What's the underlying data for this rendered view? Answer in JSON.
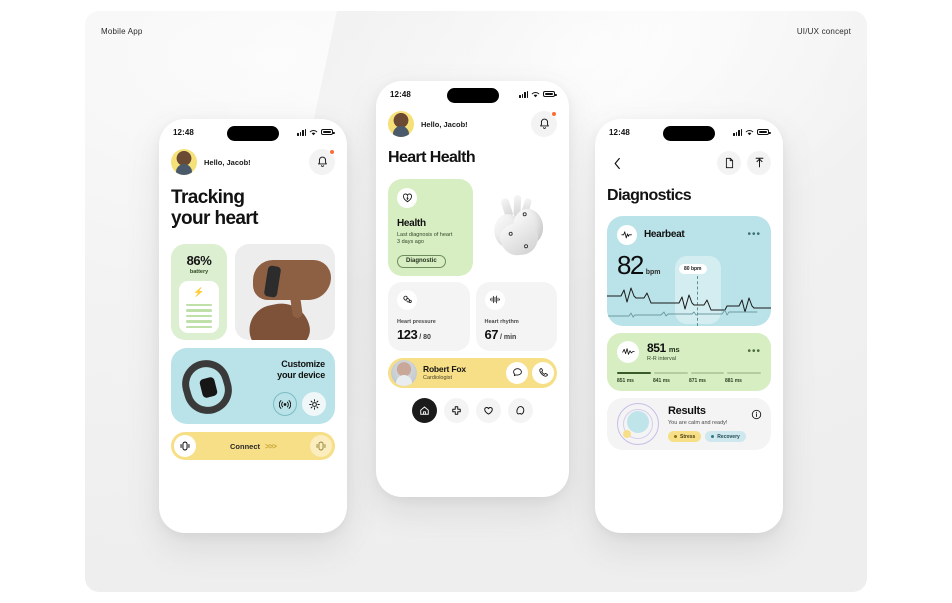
{
  "page": {
    "label_left": "Mobile App",
    "label_right": "UI/UX concept"
  },
  "status_bar": {
    "time": "12:48"
  },
  "phone1": {
    "greeting": "Hello, Jacob!",
    "bell_icon": "bell-icon",
    "title_line1": "Tracking",
    "title_line2": "your heart",
    "battery": {
      "percent": "86%",
      "label": "battery",
      "charge_icon": "bolt-icon"
    },
    "hand_image": "hand-wearing-fitness-band-photo",
    "customize": {
      "line1": "Customize",
      "line2": "your device",
      "wifi_icon": "wireless-signal-icon",
      "gear_icon": "gear-icon",
      "band_image": "fitness-band-photo"
    },
    "connect": {
      "label": "Connect",
      "chevrons": ">>>"
    }
  },
  "phone2": {
    "greeting": "Hello, Jacob!",
    "title": "Heart Health",
    "health_card": {
      "icon": "heart-shield-icon",
      "title": "Health",
      "subtitle": "Last diagnosis of heart\n3 days ago",
      "button": "Diagnostic",
      "image": "anatomical-heart-3d-render"
    },
    "metrics": [
      {
        "icon": "blood-pressure-icon",
        "label": "Heart pressure",
        "value": "123",
        "unit": "/ 80"
      },
      {
        "icon": "waveform-icon",
        "label": "Heart rhythm",
        "value": "67",
        "unit": "/ min"
      }
    ],
    "doctor": {
      "name": "Robert Fox",
      "role": "Cardiologist",
      "chat_icon": "chat-bubble-icon",
      "call_icon": "phone-icon"
    },
    "nav": [
      {
        "icon": "home-icon",
        "active": true
      },
      {
        "icon": "medical-cross-icon",
        "active": false
      },
      {
        "icon": "heart-icon",
        "active": false
      },
      {
        "icon": "profile-icon",
        "active": false
      }
    ]
  },
  "phone3": {
    "back_icon": "chevron-left-icon",
    "doc_icon": "document-icon",
    "share_icon": "upload-share-icon",
    "title": "Diagnostics",
    "heartbeat": {
      "icon": "pulse-icon",
      "title": "Hearbeat",
      "value": "82",
      "unit": "bpm",
      "tooltip": "80 bpm",
      "menu_icon": "more-dots-icon"
    },
    "rr": {
      "icon": "pulse-wave-icon",
      "value": "851",
      "unit": "ms",
      "label": "R-R interval",
      "menu_icon": "more-dots-icon",
      "ticks": [
        "851 ms",
        "841 ms",
        "871 ms",
        "881 ms"
      ]
    },
    "results": {
      "title": "Results",
      "subtitle": "You are calm and ready!",
      "info_icon": "info-icon",
      "tags": [
        {
          "label": "Stress",
          "color": "#f7df87"
        },
        {
          "label": "Recovery",
          "color": "#cfe8ee"
        }
      ]
    }
  },
  "colors": {
    "green": "#d7edc2",
    "mint": "#dcefd0",
    "cyan": "#b9e3e8",
    "yellow": "#f7df87",
    "grey": "#f4f4f4",
    "accent_dot": "#ff6b35"
  }
}
